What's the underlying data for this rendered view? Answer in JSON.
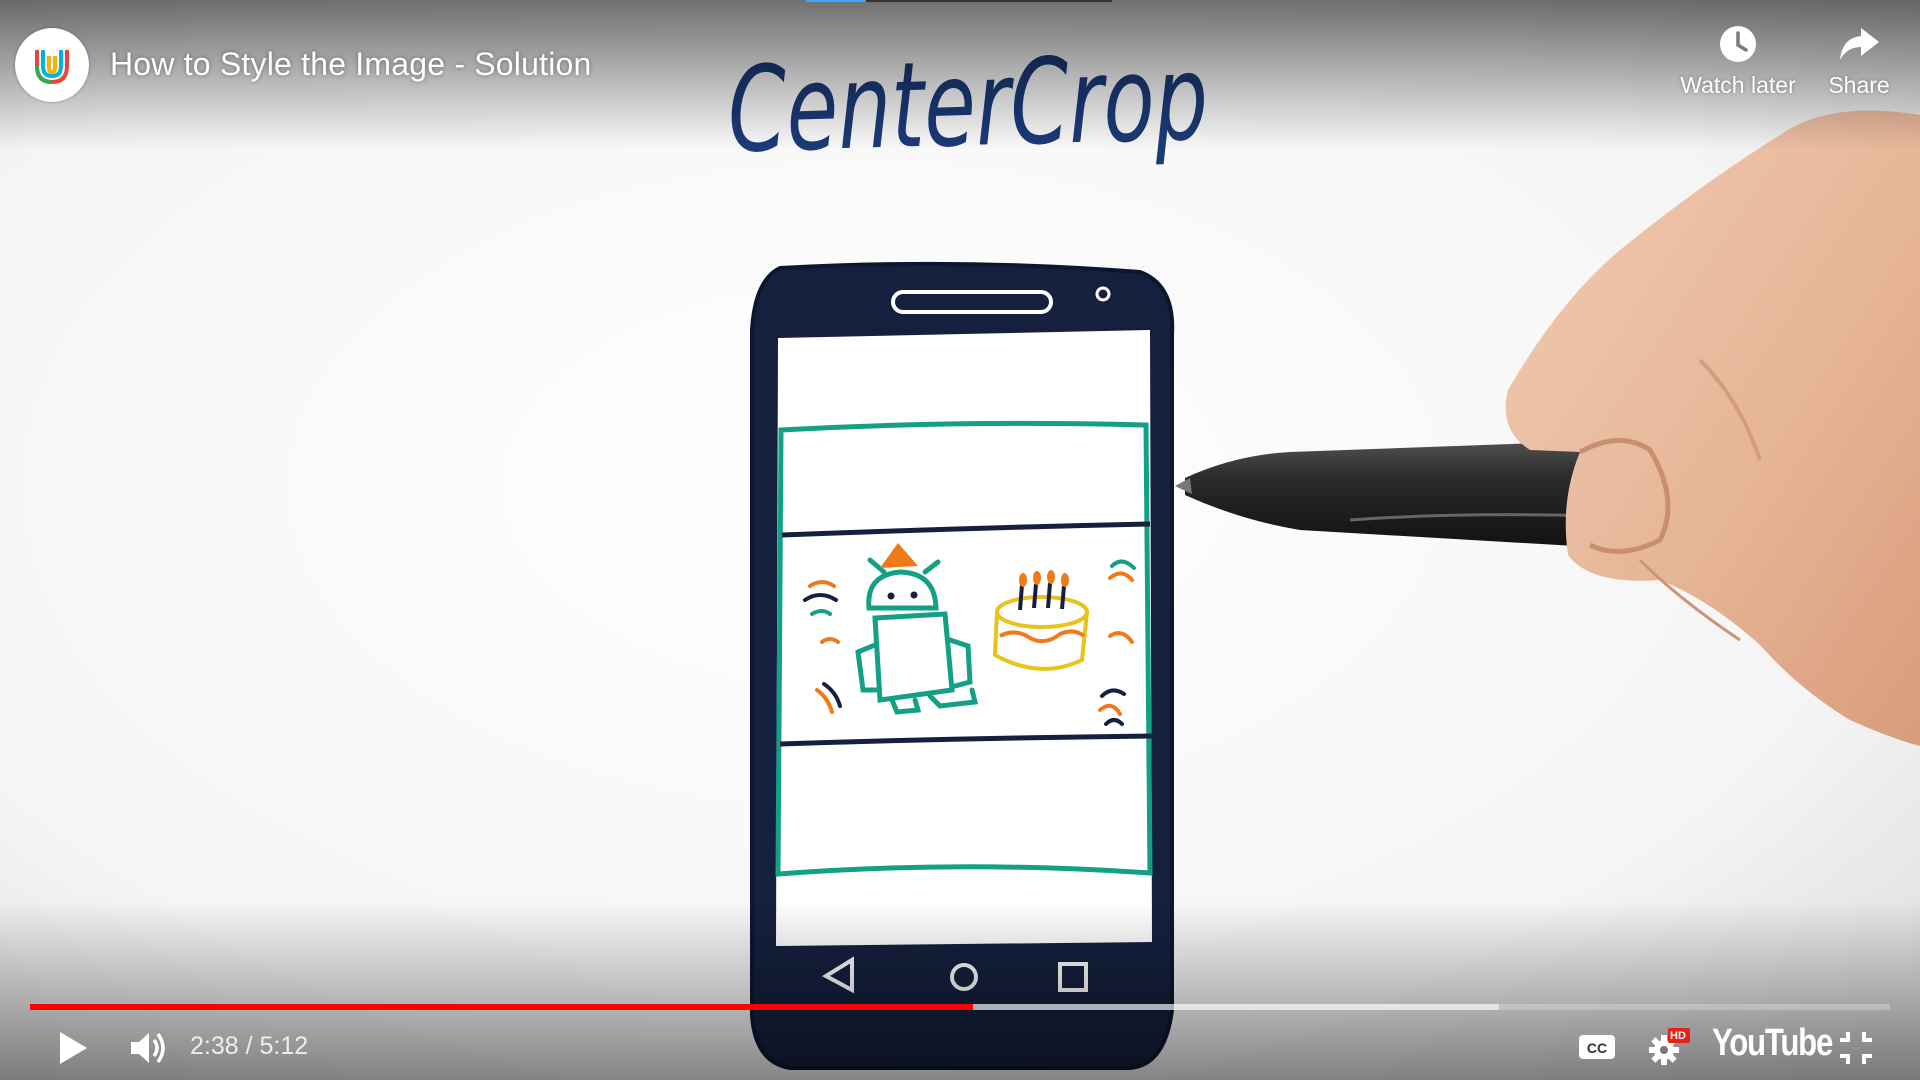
{
  "video": {
    "title": "How to Style the Image - Solution",
    "current_time": "2:38",
    "duration": "5:12",
    "time_separator": " / ",
    "progress_fraction": 0.507,
    "buffered_fraction": 0.79
  },
  "channel": {
    "avatar_icon": "udacity-logo-icon"
  },
  "top_actions": {
    "watch_later_label": "Watch later",
    "share_label": "Share"
  },
  "content": {
    "handwritten_heading": "CenterCrop"
  },
  "controls": {
    "play_icon": "play-icon",
    "volume_icon": "volume-icon",
    "captions_icon": "cc-icon",
    "settings_icon": "gear-hd-icon",
    "settings_badge": "HD",
    "logo_text": "YouTube",
    "fullscreen_icon": "exit-fullscreen-icon"
  },
  "colors": {
    "progress_played": "#ff0000",
    "sketch_teal": "#13a085",
    "sketch_navy": "#15203e",
    "sketch_orange": "#f07a1a",
    "sketch_yellow": "#e8c31a"
  }
}
